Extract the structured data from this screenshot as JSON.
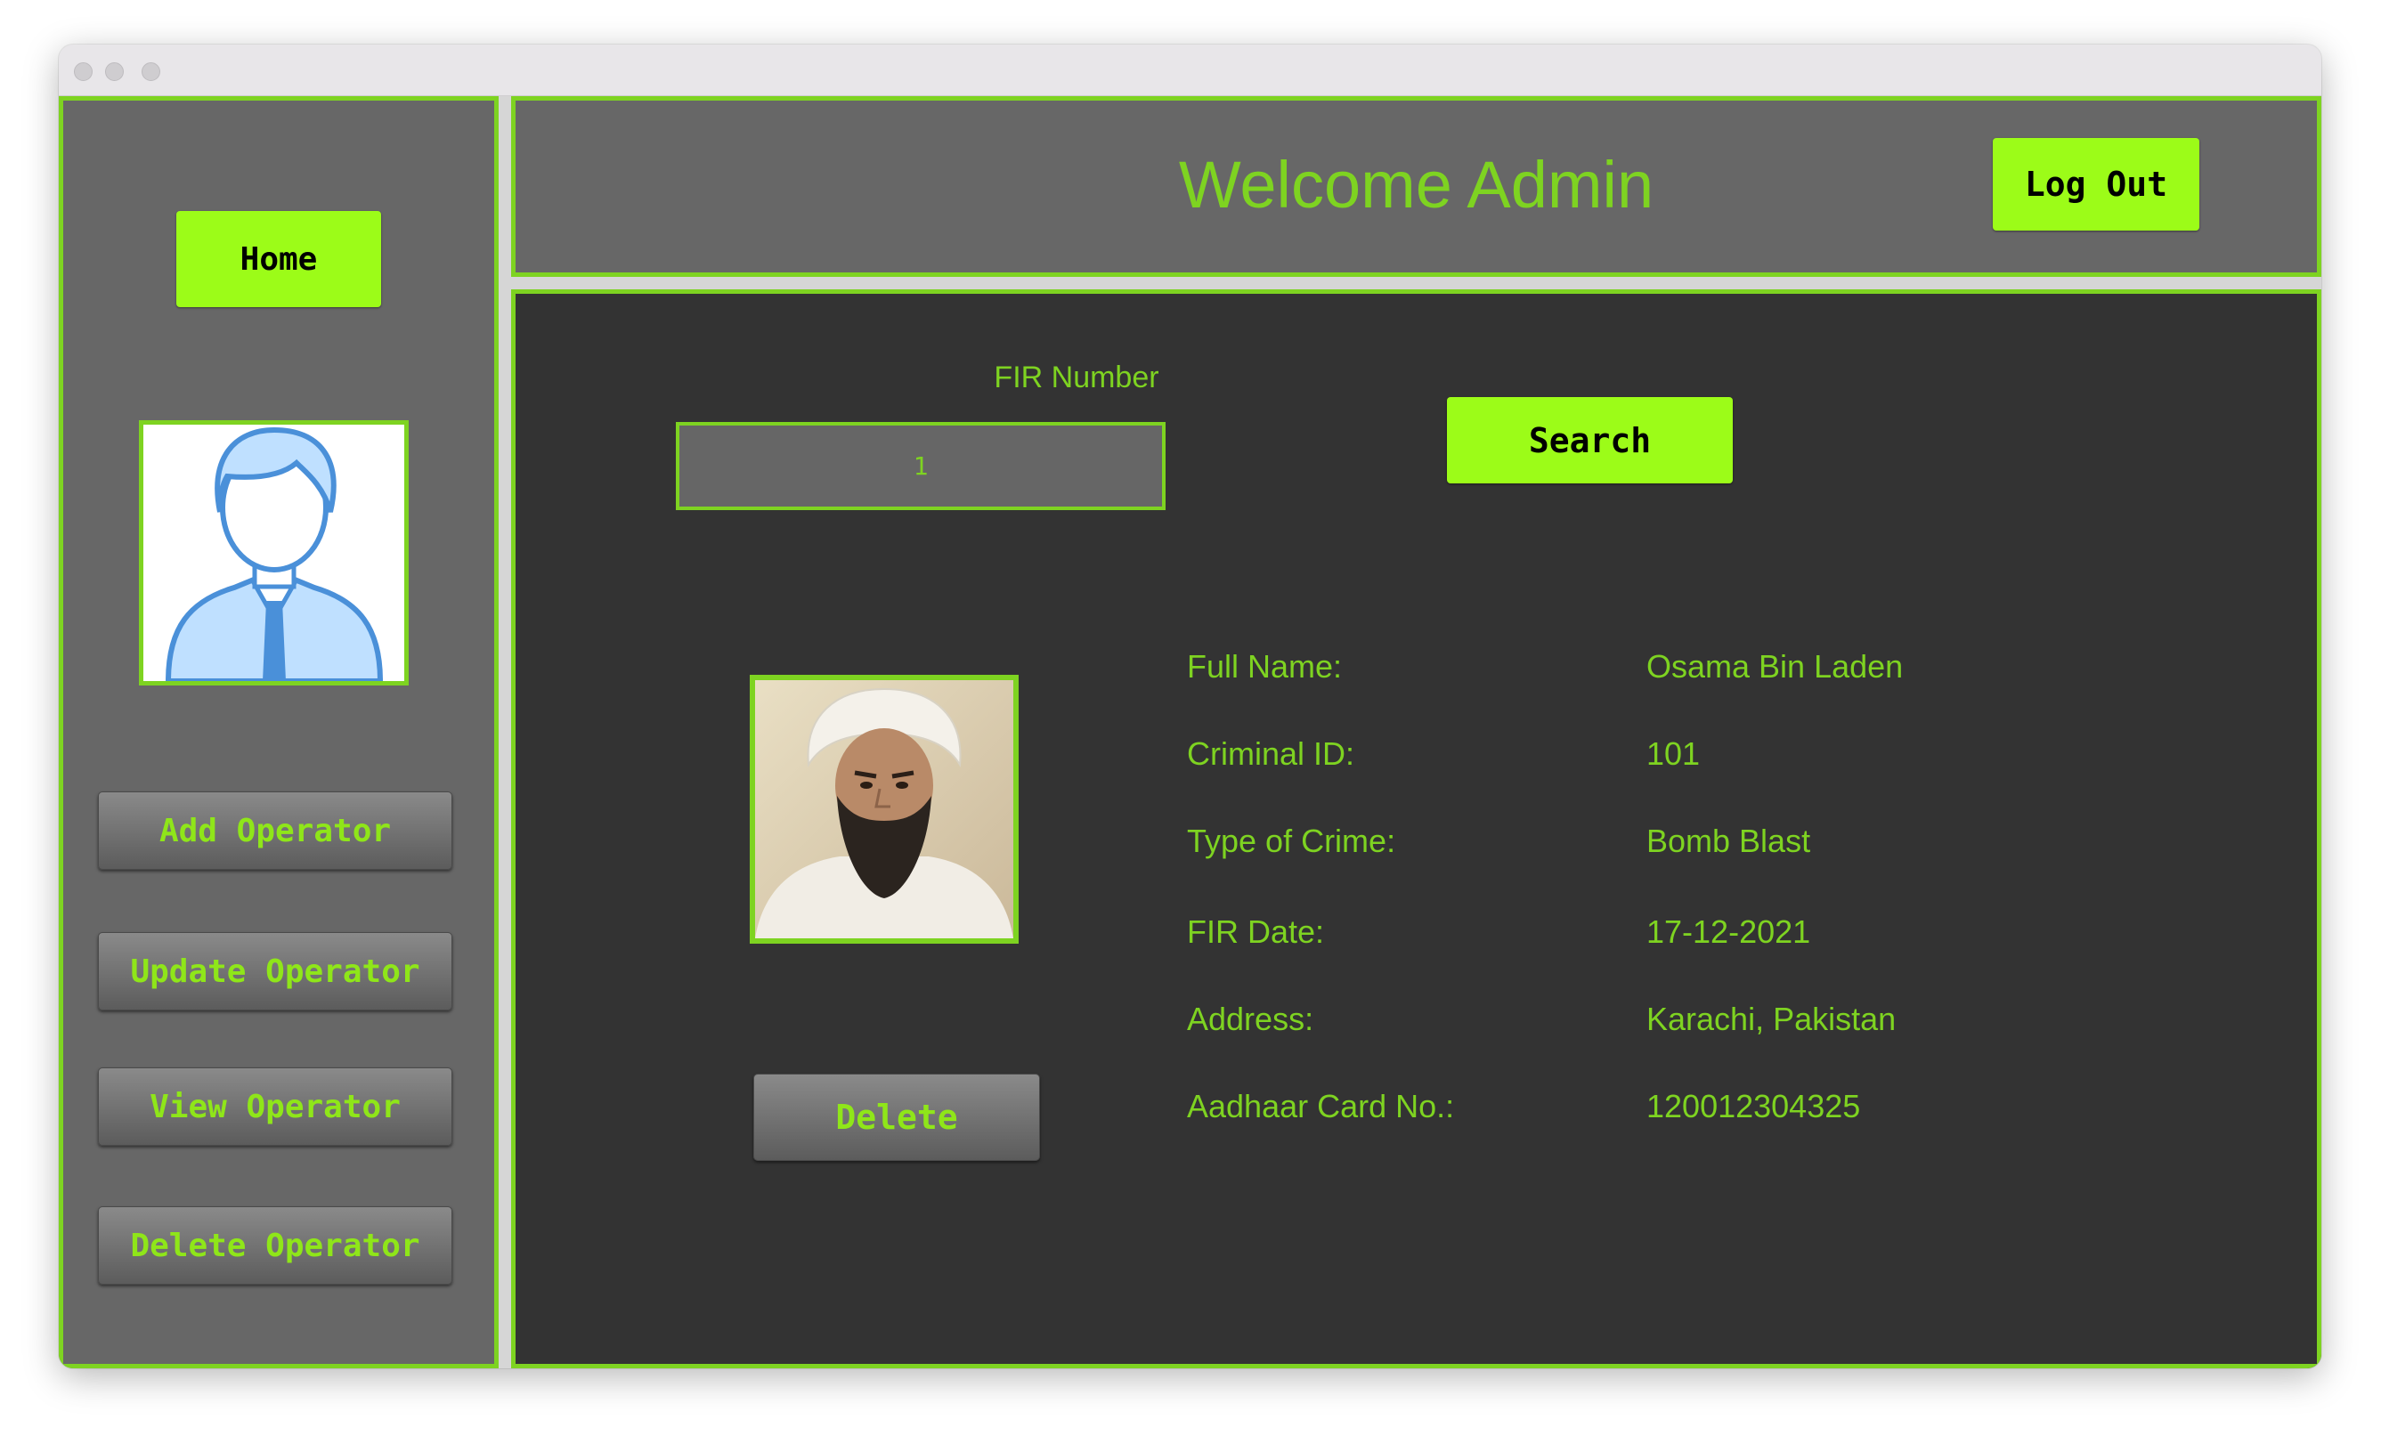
{
  "sidebar": {
    "home_label": "Home",
    "menu": [
      {
        "label": "Add Operator"
      },
      {
        "label": "Update Operator"
      },
      {
        "label": "View Operator"
      },
      {
        "label": "Delete Operator"
      }
    ]
  },
  "header": {
    "title": "Welcome Admin",
    "logout_label": "Log Out"
  },
  "search": {
    "label": "FIR Number",
    "value": "1",
    "button_label": "Search"
  },
  "record": {
    "fields": [
      {
        "label": "Full Name:",
        "value": "Osama Bin Laden"
      },
      {
        "label": "Criminal ID:",
        "value": "101"
      },
      {
        "label": "Type of Crime:",
        "value": "Bomb Blast"
      },
      {
        "label": "FIR Date:",
        "value": "17-12-2021"
      },
      {
        "label": "Address:",
        "value": "Karachi, Pakistan"
      },
      {
        "label": "Aadhaar Card No.:",
        "value": "120012304325"
      }
    ],
    "delete_label": "Delete"
  },
  "colors": {
    "accent": "#7ed321",
    "button_green": "#9cfc18",
    "panel_grey": "#676767",
    "content_dark": "#333333"
  },
  "icons": {
    "avatar": "user-avatar-icon",
    "photo": "suspect-photo"
  }
}
